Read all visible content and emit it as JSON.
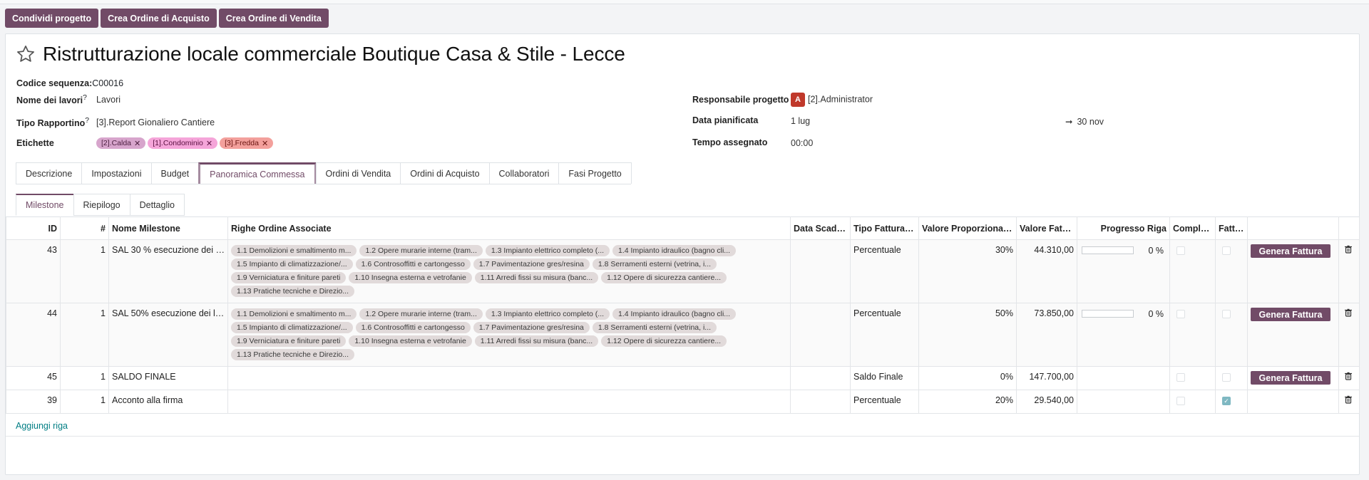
{
  "actions": {
    "share": "Condividi progetto",
    "purchase": "Crea Ordine di Acquisto",
    "sale": "Crea Ordine di Vendita"
  },
  "project": {
    "title": "Ristrutturazione locale commerciale Boutique Casa & Stile - Lecce",
    "seq_label": "Codice sequenza:",
    "seq_value": "C00016",
    "work_label": "Nome dei lavori",
    "work_value": "Lavori",
    "report_label": "Tipo Rapportino",
    "report_value": "[3].Report Gionaliero Cantiere",
    "tags_label": "Etichette",
    "tags": [
      "[2].Calda",
      "[1].Condominio",
      "[3].Fredda"
    ],
    "manager_label": "Responsabile progetto",
    "manager_avatar": "A",
    "manager_value": "[2].Administrator",
    "planned_label": "Data pianificata",
    "planned_start": "1 lug",
    "planned_end": "30 nov",
    "time_label": "Tempo assegnato",
    "time_value": "00:00"
  },
  "tabs": [
    "Descrizione",
    "Impostazioni",
    "Budget",
    "Panoramica Commessa",
    "Ordini di Vendita",
    "Ordini di Acquisto",
    "Collaboratori",
    "Fasi Progetto"
  ],
  "subtabs": [
    "Milestone",
    "Riepilogo",
    "Dettaglio"
  ],
  "table": {
    "headers": [
      "ID",
      "#",
      "Nome Milestone",
      "Righe Ordine Associate",
      "Data Scade...",
      "Tipo Fatturazi...",
      "Valore Proporzionale ...",
      "Valore Fattu...",
      "Progresso Riga",
      "Comple...",
      "Fattu..."
    ],
    "order_lines": [
      "1.1 Demolizioni e smaltimento m...",
      "1.2 Opere murarie interne (tram...",
      "1.3 Impianto elettrico completo (...",
      "1.4 Impianto idraulico (bagno cli...",
      "1.5 Impianto di climatizzazione/...",
      "1.6 Controsoffitti e cartongesso",
      "1.7 Pavimentazione gres/resina",
      "1.8 Serramenti esterni (vetrina, i...",
      "1.9 Verniciatura e finiture pareti",
      "1.10 Insegna esterna e vetrofanie",
      "1.11 Arredi fissi su misura (banc...",
      "1.12 Opere di sicurezza cantiere...",
      "1.13 Pratiche tecniche e Direzio..."
    ],
    "rows": [
      {
        "id": "43",
        "seq": "1",
        "name": "SAL 30 % esecuzione dei la...",
        "type": "Percentuale",
        "prop": "30%",
        "amount": "44.310,00",
        "progress": "0 %",
        "button": "Genera Fattura"
      },
      {
        "id": "44",
        "seq": "1",
        "name": "SAL 50% esecuzione dei la...",
        "type": "Percentuale",
        "prop": "50%",
        "amount": "73.850,00",
        "progress": "0 %",
        "button": "Genera Fattura"
      },
      {
        "id": "45",
        "seq": "1",
        "name": "SALDO FINALE",
        "type": "Saldo Finale",
        "prop": "0%",
        "amount": "147.700,00",
        "button": "Genera Fattura"
      },
      {
        "id": "39",
        "seq": "1",
        "name": "Acconto alla firma",
        "type": "Percentuale",
        "prop": "20%",
        "amount": "29.540,00"
      }
    ],
    "progress_values": [
      0,
      0
    ],
    "add_line": "Aggiungi riga"
  },
  "colors": {
    "brand": "#714b67",
    "link": "#017e84"
  }
}
